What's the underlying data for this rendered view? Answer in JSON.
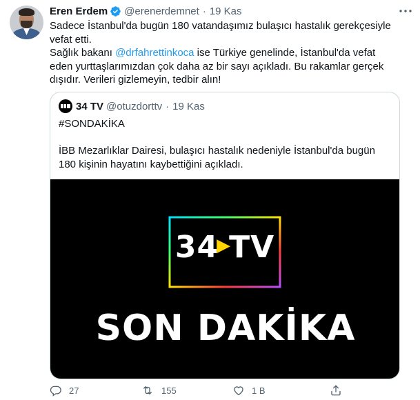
{
  "colors": {
    "link": "#1d9bf0",
    "verified": "#1d9bf0",
    "muted": "#536471",
    "border": "#cfd9de"
  },
  "tweet": {
    "author_name": "Eren Erdem",
    "author_handle": "@erenerdemnet",
    "separator": "·",
    "timestamp": "19 Kas",
    "line1": "Sadece İstanbul'da bugün 180 vatandaşımız bulaşıcı hastalık gerekçesiyle vefat etti.",
    "line2_prefix": "Sağlık bakanı ",
    "mention": "@drfahrettinkoca",
    "line2_suffix": " ise Türkiye genelinde, İstanbul'da vefat eden yurttaşlarımızdan çok daha az bir sayı açıkladı. Bu rakamlar gerçek dışıdır. Verileri gizlemeyin, tedbir alın!"
  },
  "quote": {
    "author_name": "34 TV",
    "author_handle": "@otuzdorttv",
    "separator": "·",
    "timestamp": "19 Kas",
    "hashtag": "#SONDAKİKA",
    "text": "İBB Mezarlıklar Dairesi, bulaşıcı hastalık nedeniyle İstanbul'da bugün 180 kişinin hayatını kaybettiğini açıkladı.",
    "media": {
      "logo_left": "34",
      "logo_right": "TV",
      "headline": "SON DAKİKA"
    }
  },
  "actions": {
    "reply_count": "27",
    "retweet_count": "155",
    "like_count": "1 B"
  }
}
